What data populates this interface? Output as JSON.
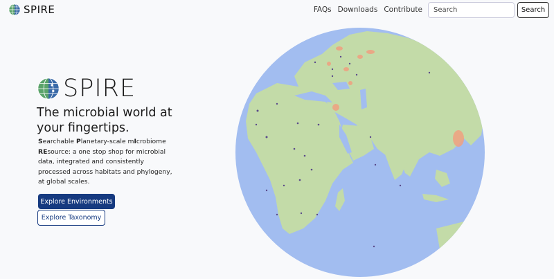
{
  "brand": {
    "name": "SPIRE"
  },
  "nav": {
    "links": [
      "FAQs",
      "Downloads",
      "Contribute"
    ]
  },
  "search": {
    "placeholder": "Search",
    "button_label": "Search"
  },
  "hero": {
    "logo_text": "SPIRE",
    "title": "The microbial world at your fingertips.",
    "desc": {
      "w1_bold": "S",
      "w1_rest": "earchable ",
      "w2_bold": "P",
      "w2_rest": "lanetary-scale m",
      "w3_bold": "I",
      "w3_rest": "crobiome",
      "w4_bold": "RE",
      "w4_rest": "source: a one stop shop for microbial data, integrated and consistently processed across habitats and phylogeny, at global scales."
    },
    "primary_button": "Explore Environments",
    "secondary_button": "Explore Taxonomy"
  },
  "colors": {
    "ocean": "#a2bdf0",
    "land": "#c3dba8",
    "brand_blue": "#163a80",
    "sample_dot": "#5a4a8a",
    "sample_cluster": "#f0a080"
  }
}
